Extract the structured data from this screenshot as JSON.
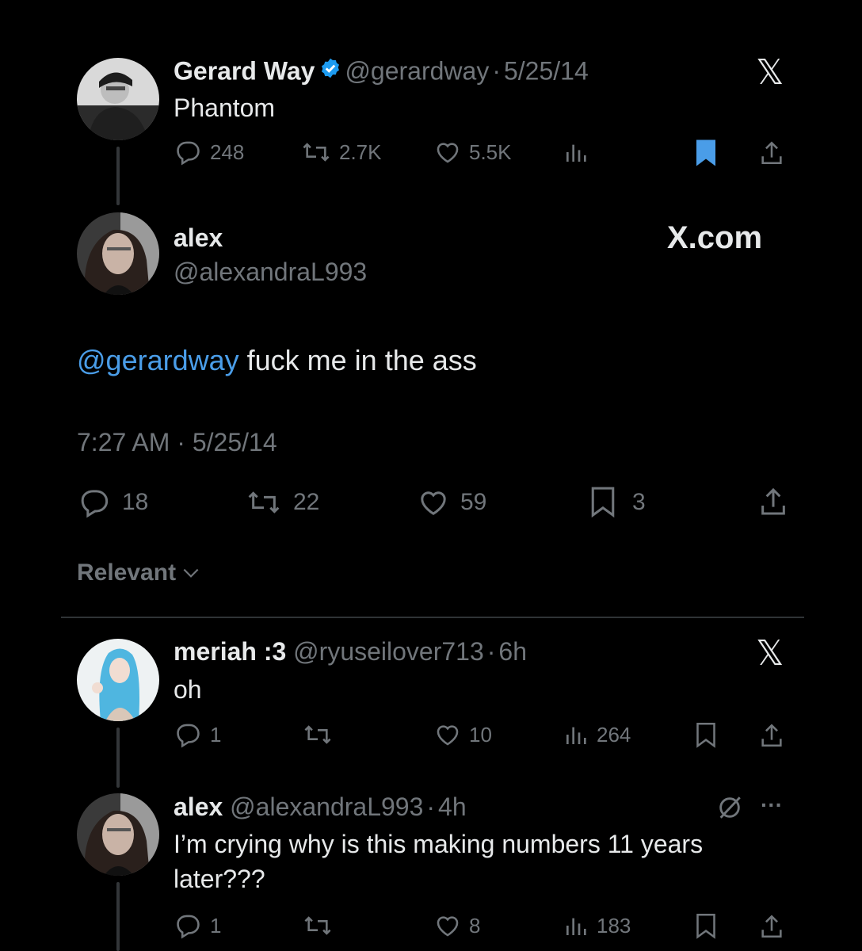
{
  "parent_tweet": {
    "display_name": "Gerard Way",
    "handle": "@gerardway",
    "separator": "·",
    "date": "5/25/14",
    "text": "Phantom",
    "replies": "248",
    "retweets": "2.7K",
    "likes": "5.5K",
    "icons": [
      "reply-icon",
      "retweet-icon",
      "like-icon",
      "views-icon",
      "bookmark-filled-icon",
      "share-icon",
      "x-logo-icon"
    ],
    "bookmark_color": "#4a9de8"
  },
  "main_tweet": {
    "display_name": "alex",
    "handle": "@alexandraL993",
    "watermark": "X.com",
    "mention": "@gerardway",
    "text": " fuck me in the ass",
    "timestamp": "7:27 AM · 5/25/14",
    "replies": "18",
    "retweets": "22",
    "likes": "59",
    "bookmarks": "3"
  },
  "sort": {
    "label": "Relevant",
    "icon": "chevron-down-icon"
  },
  "replies": [
    {
      "display_name": "meriah :3",
      "handle": "@ryuseilover713",
      "separator": "·",
      "age": "6h",
      "text": "oh",
      "replies": "1",
      "likes": "10",
      "views": "264"
    },
    {
      "display_name": "alex",
      "handle": "@alexandraL993",
      "separator": "·",
      "age": "4h",
      "text_line1": "I’m crying why is this making numbers 11 years",
      "text_line2": "later???",
      "replies": "1",
      "likes": "8",
      "views": "183",
      "more": "···"
    }
  ],
  "colors": {
    "background": "#000000",
    "text": "#e7e9ea",
    "muted": "#71767b",
    "link": "#4a9de8",
    "divider": "#2f3336"
  }
}
